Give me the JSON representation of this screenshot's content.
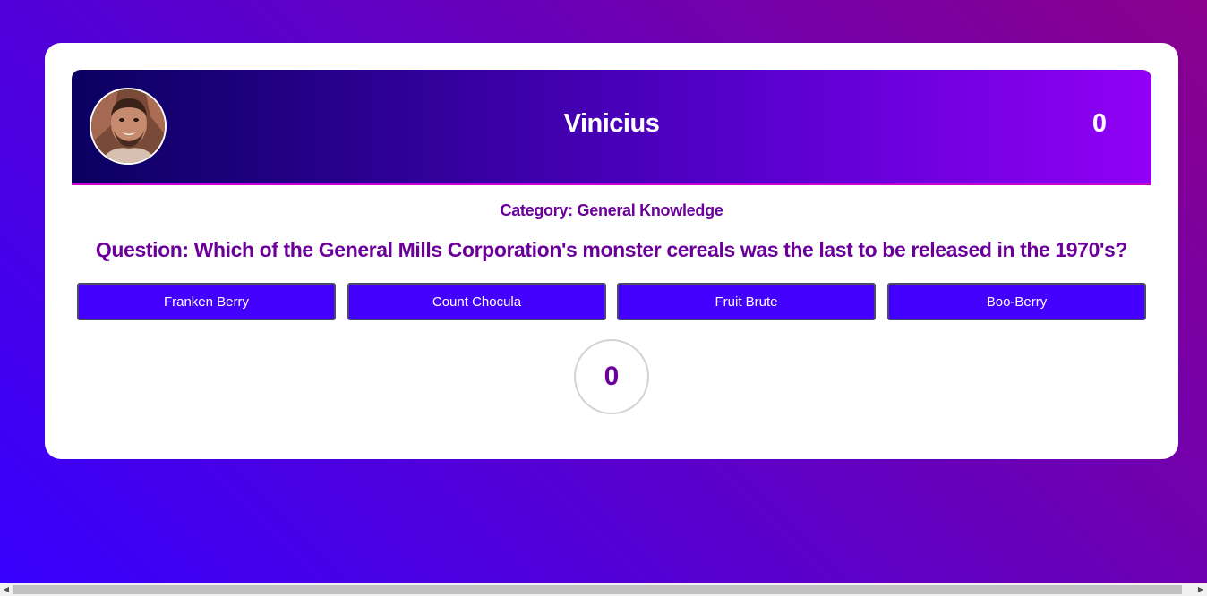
{
  "header": {
    "player_name": "Vinicius",
    "score": "0",
    "avatar_icon": "user-photo"
  },
  "quiz": {
    "category": "Category: General Knowledge",
    "question": "Question: Which of the General Mills Corporation's monster cereals was the last to be released in the 1970's?",
    "answers": [
      {
        "label": "Franken Berry"
      },
      {
        "label": "Count Chocula"
      },
      {
        "label": "Fruit Brute"
      },
      {
        "label": "Boo-Berry"
      }
    ],
    "timer": "0"
  },
  "colors": {
    "answer_button": "#4400ff",
    "text_accent": "#6a0099",
    "header_border": "#cc00cc"
  },
  "scrollbar": {
    "left_arrow_icon": "scroll-left-icon",
    "right_arrow_icon": "scroll-right-icon"
  }
}
